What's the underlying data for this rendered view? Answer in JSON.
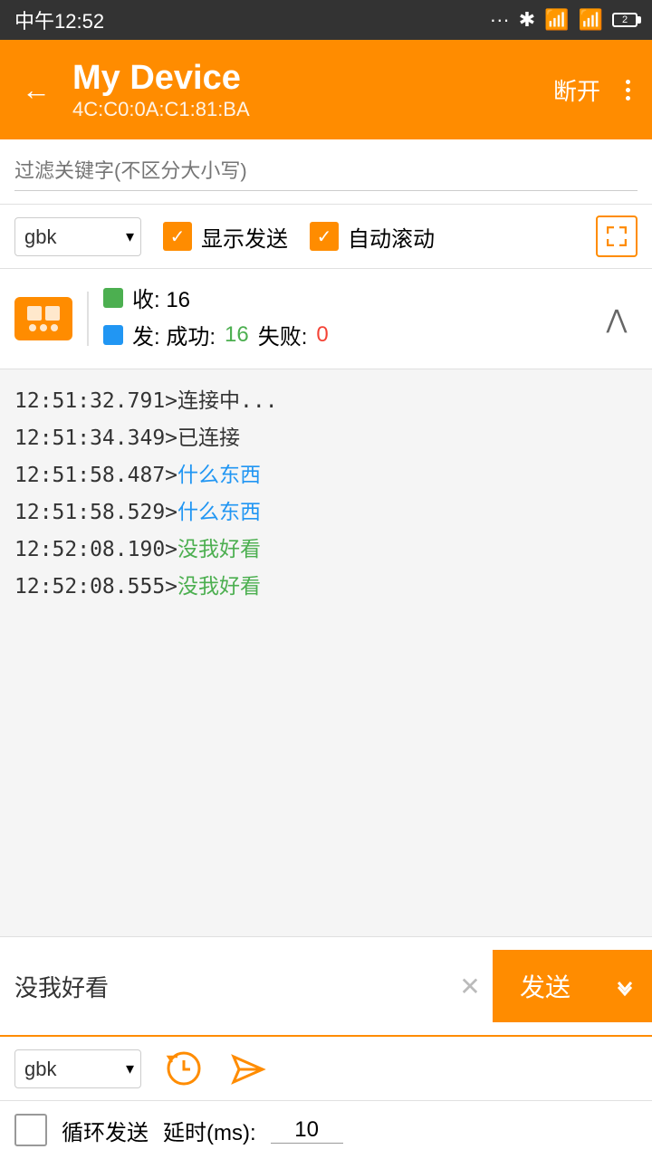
{
  "statusBar": {
    "time": "中午12:52",
    "battery": "2"
  },
  "header": {
    "title": "My Device",
    "subtitle": "4C:C0:0A:C1:81:BA",
    "disconnectLabel": "断开",
    "moreLabel": "更多"
  },
  "filterBar": {
    "placeholder": "过滤关键字(不区分大小写)"
  },
  "controls": {
    "encoding": "gbk",
    "showSendLabel": "显示发送",
    "autoScrollLabel": "自动滚动"
  },
  "stats": {
    "recvLabel": "收: 16",
    "sendLabel": "发: 成功: 16 失败: 0",
    "successCount": "16",
    "failCount": "0"
  },
  "logs": [
    {
      "time": "12:51:32.791>",
      "text": " 连接中...",
      "type": "default"
    },
    {
      "time": "12:51:34.349>",
      "text": " 已连接",
      "type": "default"
    },
    {
      "time": "12:51:58.487>",
      "text": " 什么东西",
      "type": "blue"
    },
    {
      "time": "12:51:58.529>",
      "text": " 什么东西",
      "type": "blue"
    },
    {
      "time": "12:52:08.190>",
      "text": " 没我好看",
      "type": "green"
    },
    {
      "time": "12:52:08.555>",
      "text": " 没我好看",
      "type": "green"
    }
  ],
  "bottomInput": {
    "value": "没我好看",
    "sendLabel": "发送",
    "encoding": "gbk",
    "loopLabel": "循环发送",
    "delayLabel": "延时(ms):",
    "delayValue": "10"
  }
}
